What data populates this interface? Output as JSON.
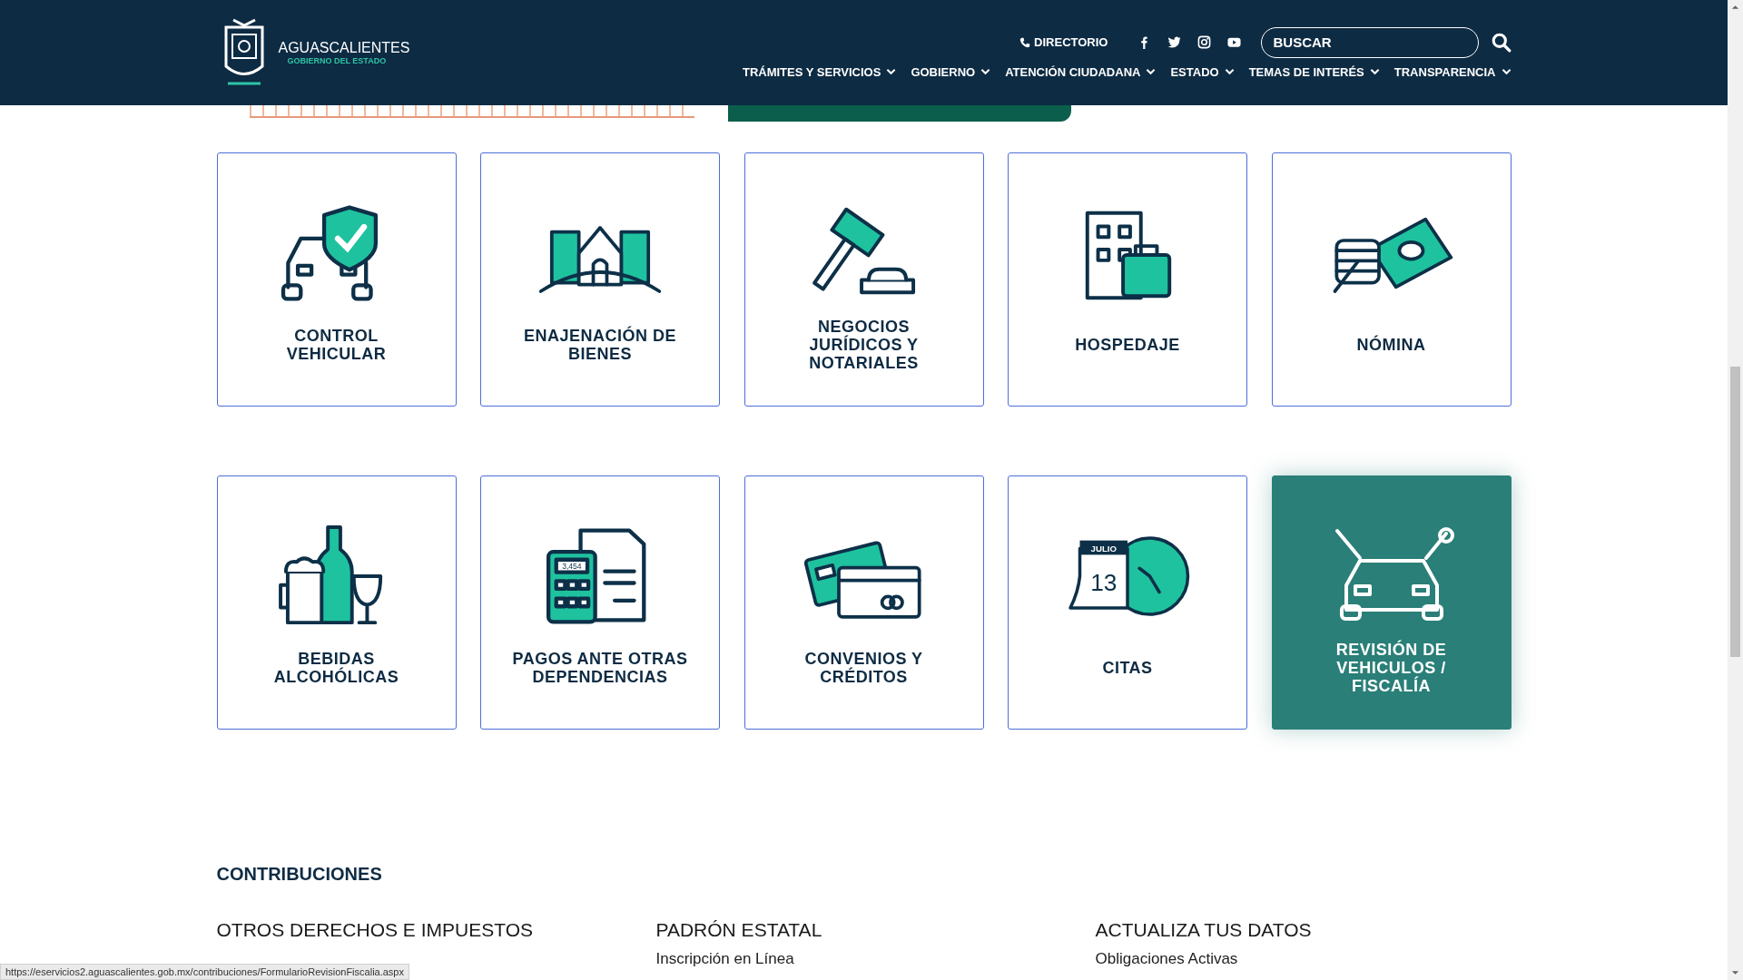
{
  "header": {
    "logo": {
      "title": "AGUASCALIENTES",
      "subtitle": "GOBIERNO DEL ESTADO"
    },
    "directory_link": "DIRECTORIO",
    "search": {
      "placeholder": "BUSCAR"
    },
    "nav": [
      {
        "label": "TRÁMITES Y SERVICIOS"
      },
      {
        "label": "GOBIERNO"
      },
      {
        "label": "ATENCIÓN CIUDADANA"
      },
      {
        "label": "ESTADO"
      },
      {
        "label": "TEMAS DE INTERÉS"
      },
      {
        "label": "TRANSPARENCIA"
      }
    ]
  },
  "cards": [
    {
      "label": "CONTROL VEHICULAR",
      "selected": false
    },
    {
      "label": "ENAJENACIÓN DE BIENES",
      "selected": false
    },
    {
      "label": "NEGOCIOS JURÍDICOS Y NOTARIALES",
      "selected": false
    },
    {
      "label": "HOSPEDAJE",
      "selected": false
    },
    {
      "label": "NÓMINA",
      "selected": false
    },
    {
      "label": "BEBIDAS ALCOHÓLICAS",
      "selected": false
    },
    {
      "label": "PAGOS ANTE OTRAS DEPENDENCIAS",
      "selected": false
    },
    {
      "label": "CONVENIOS Y CRÉDITOS",
      "selected": false
    },
    {
      "label": "CITAS",
      "selected": false
    },
    {
      "label": "REVISIÓN DE VEHICULOS / FISCALÍA",
      "selected": true
    }
  ],
  "contributions": {
    "title": "CONTRIBUCIONES",
    "columns": [
      {
        "title": "OTROS DERECHOS E IMPUESTOS"
      },
      {
        "title": "PADRÓN ESTATAL",
        "links": [
          "Inscripción en Línea"
        ]
      },
      {
        "title": "ACTUALIZA TUS DATOS",
        "links": [
          "Obligaciones Activas"
        ]
      }
    ]
  },
  "calendar": {
    "month": "JULIO",
    "day": "13"
  },
  "calculator": {
    "display": "3,454"
  },
  "status_bar": {
    "url": "https://eservicios2.aguascalientes.gob.mx/contribuciones/FormularioRevisionFiscalia.aspx"
  }
}
